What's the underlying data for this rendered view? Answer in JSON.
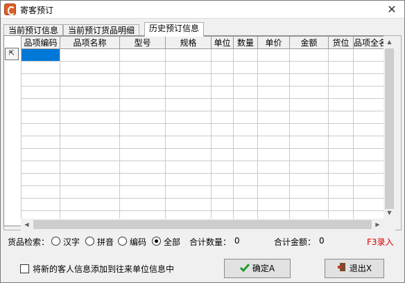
{
  "window": {
    "title": "寄客预订",
    "close_glyph": "✕"
  },
  "tabs": [
    {
      "label": "当前预订信息",
      "active": false
    },
    {
      "label": "当前预订货品明细",
      "active": false
    },
    {
      "label": "历史预订信息",
      "active": true
    }
  ],
  "grid": {
    "columns": [
      "品项编码",
      "品项名称",
      "型号",
      "规格",
      "单位",
      "数量",
      "单价",
      "金额",
      "货位",
      "品项全名"
    ],
    "row_count": 14,
    "selected_row": 0,
    "selected_col": 0,
    "gutter_glyph": "⇱"
  },
  "filter": {
    "label": "货品检索：",
    "options": [
      {
        "label": "汉字",
        "checked": false
      },
      {
        "label": "拼音",
        "checked": false
      },
      {
        "label": "编码",
        "checked": false
      },
      {
        "label": "全部",
        "checked": true
      }
    ],
    "total_qty_label": "合计数量：",
    "total_qty_value": "0",
    "total_amount_label": "合计金额：",
    "total_amount_value": "0",
    "hotkey": "F3录入"
  },
  "footer": {
    "checkbox_label": "将新的客人信息添加到往来单位信息中",
    "checkbox_checked": false,
    "confirm_label": "确定A",
    "exit_label": "退出X"
  },
  "colors": {
    "selection": "#0078d7",
    "hotkey": "#d40000",
    "confirm_icon": "#1f9d2a",
    "exit_icon": "#c0392b"
  },
  "icons": {
    "app": "app-logo-icon",
    "close": "close-icon",
    "gutter": "corner-arrow-icon",
    "confirm": "checkmark-icon",
    "exit": "exit-door-icon"
  }
}
